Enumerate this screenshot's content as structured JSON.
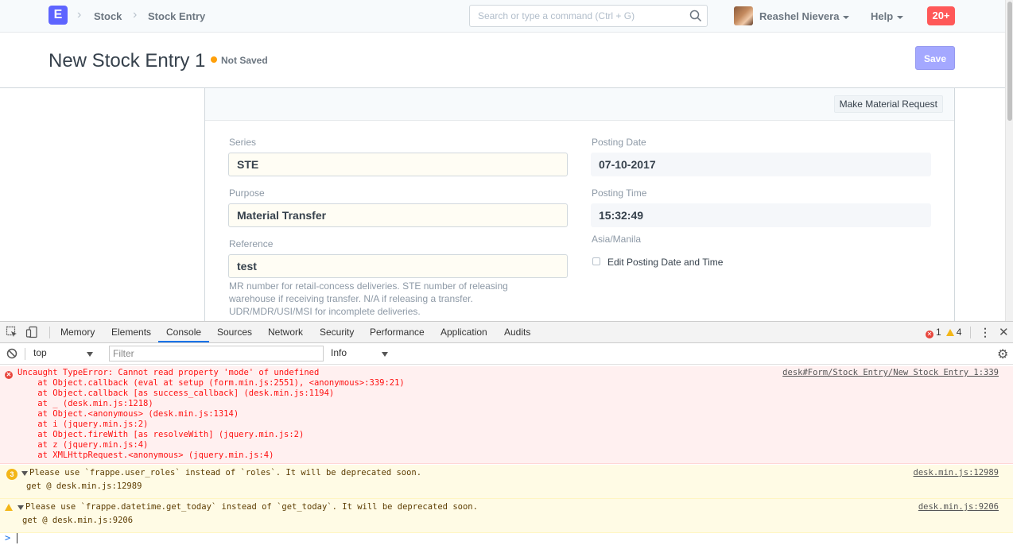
{
  "navbar": {
    "logo": "E",
    "breadcrumbs": [
      "Stock",
      "Stock Entry"
    ],
    "search_placeholder": "Search or type a command (Ctrl + G)",
    "user_name": "Reashel Nievera",
    "help_label": "Help",
    "notification_count": "20+"
  },
  "page": {
    "title": "New Stock Entry 1",
    "status": "Not Saved",
    "save_label": "Save"
  },
  "form": {
    "toolbar_button": "Make Material Request",
    "fields": {
      "series_label": "Series",
      "series_value": "STE",
      "purpose_label": "Purpose",
      "purpose_value": "Material Transfer",
      "reference_label": "Reference",
      "reference_value": "test",
      "reference_description_lines": [
        "MR number for retail-concess deliveries. STE number of releasing",
        "warehouse if receiving transfer. N/A if releasing a transfer.",
        "UDR/MDR/USI/MSI for incomplete deliveries."
      ],
      "posting_date_label": "Posting Date",
      "posting_date_value": "07-10-2017",
      "posting_time_label": "Posting Time",
      "posting_time_value": "15:32:49",
      "timezone": "Asia/Manila",
      "edit_posting_label": "Edit Posting Date and Time"
    }
  },
  "devtools": {
    "tabs": [
      "Memory",
      "Elements",
      "Console",
      "Sources",
      "Network",
      "Security",
      "Performance",
      "Application",
      "Audits"
    ],
    "active_tab": "Console",
    "error_count": "1",
    "warning_count": "4",
    "context": "top",
    "filter_placeholder": "Filter",
    "level": "Info",
    "error_message": {
      "lines": [
        "Uncaught TypeError: Cannot read property 'mode' of undefined",
        "    at Object.callback (eval at setup (form.min.js:2551), <anonymous>:339:21)",
        "    at Object.callback [as success_callback] (desk.min.js:1194)",
        "    at _ (desk.min.js:1218)",
        "    at Object.<anonymous> (desk.min.js:1314)",
        "    at i (jquery.min.js:2)",
        "    at Object.fireWith [as resolveWith] (jquery.min.js:2)",
        "    at z (jquery.min.js:4)",
        "    at XMLHttpRequest.<anonymous> (jquery.min.js:4)"
      ],
      "source": "desk#Form/Stock Entry/New Stock Entry 1:339"
    },
    "warning_1": {
      "count": "3",
      "text": "Please use `frappe.user_roles` instead of `roles`. It will be deprecated soon.",
      "sub": "get @ desk.min.js:12989",
      "source": "desk.min.js:12989"
    },
    "warning_2": {
      "text": "Please use `frappe.datetime.get_today` instead of `get_today`. It will be deprecated soon.",
      "sub": "get @ desk.min.js:9206",
      "source": "desk.min.js:9206"
    },
    "prompt": ">"
  },
  "colors": {
    "brand": "#5e64ff",
    "notification": "#ff5858",
    "status_dot": "#ffa00a",
    "save_button": "#a4a8ff"
  }
}
